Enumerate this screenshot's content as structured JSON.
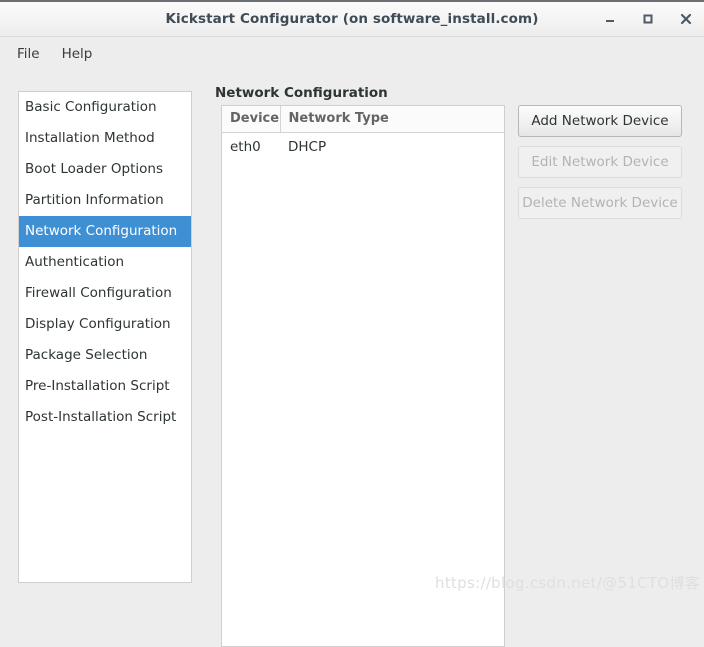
{
  "window": {
    "title": "Kickstart Configurator (on software_install.com)",
    "controls": [
      {
        "name": "minimize-button",
        "icon": "minimize-icon"
      },
      {
        "name": "maximize-button",
        "icon": "maximize-icon"
      },
      {
        "name": "close-button",
        "icon": "close-icon"
      }
    ]
  },
  "menu": {
    "items": [
      {
        "label": "File"
      },
      {
        "label": "Help"
      }
    ]
  },
  "sidebar": {
    "items": [
      {
        "label": "Basic Configuration",
        "selected": false
      },
      {
        "label": "Installation Method",
        "selected": false
      },
      {
        "label": "Boot Loader Options",
        "selected": false
      },
      {
        "label": "Partition Information",
        "selected": false
      },
      {
        "label": "Network Configuration",
        "selected": true
      },
      {
        "label": "Authentication",
        "selected": false
      },
      {
        "label": "Firewall Configuration",
        "selected": false
      },
      {
        "label": "Display Configuration",
        "selected": false
      },
      {
        "label": "Package Selection",
        "selected": false
      },
      {
        "label": "Pre-Installation Script",
        "selected": false
      },
      {
        "label": "Post-Installation Script",
        "selected": false
      }
    ]
  },
  "content": {
    "heading": "Network Configuration",
    "table": {
      "columns": [
        "Device",
        "Network Type"
      ],
      "rows": [
        {
          "device": "eth0",
          "network_type": "DHCP"
        }
      ]
    },
    "buttons": [
      {
        "label": "Add Network Device",
        "enabled": true
      },
      {
        "label": "Edit Network Device",
        "enabled": false
      },
      {
        "label": "Delete Network Device",
        "enabled": false
      }
    ]
  },
  "watermark": {
    "text": "https://blog.csdn.net/@51CTO博客"
  },
  "colors": {
    "selection_blue": "#3f8fd4",
    "window_background": "#ededed",
    "panel_background": "#ffffff",
    "title_text": "#3f4b55"
  }
}
